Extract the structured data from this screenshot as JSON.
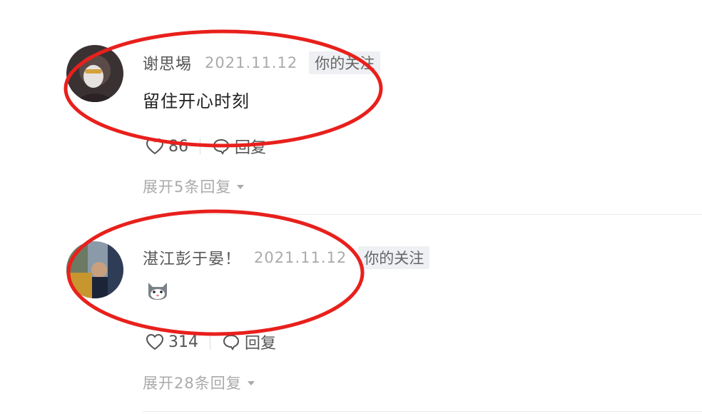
{
  "comments": [
    {
      "username": "谢思埸",
      "date": "2021.11.12",
      "badge": "你的关注",
      "text": "留住开心时刻",
      "likes": "86",
      "reply_label": "回复",
      "expand_label": "展开5条回复"
    },
    {
      "username": "湛江彭于晏！",
      "date": "2021.11.12",
      "badge": "你的关注",
      "text": "",
      "likes": "314",
      "reply_label": "回复",
      "expand_label": "展开28条回复"
    }
  ],
  "colors": {
    "annotation_ring": "#e8201c",
    "muted_text": "#aaaaaa",
    "badge_bg": "#eef0f3"
  }
}
